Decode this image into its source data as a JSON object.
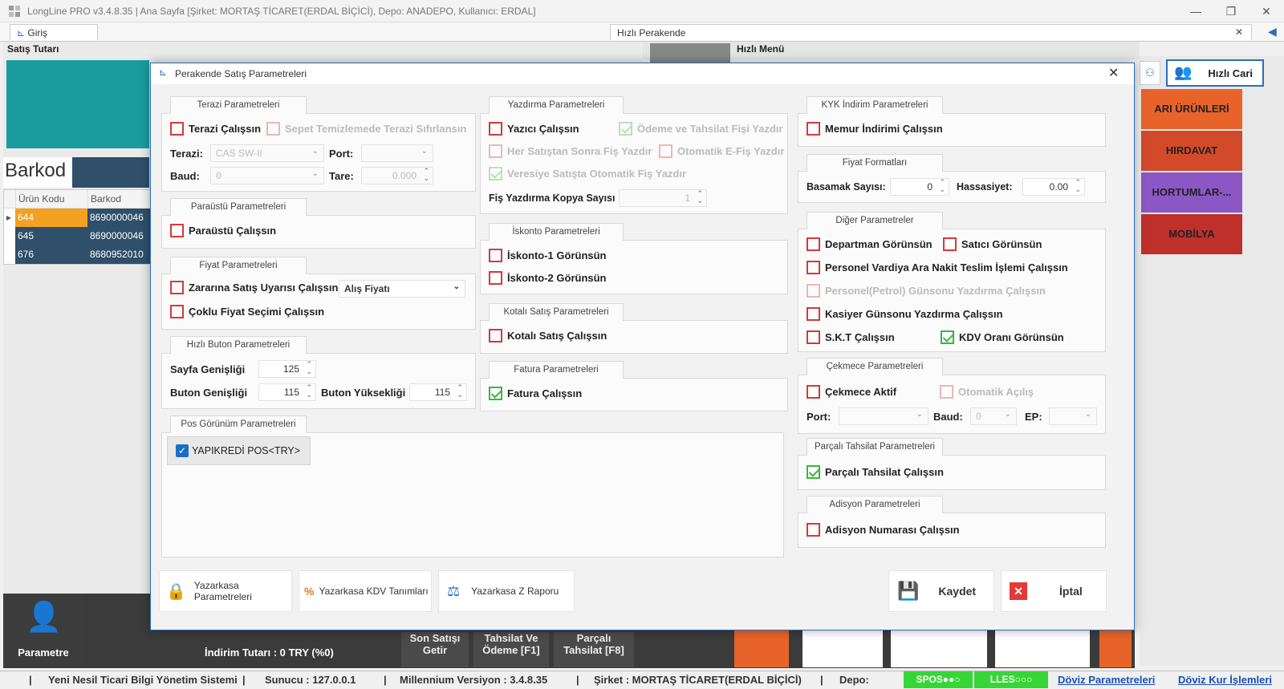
{
  "window": {
    "title": "LongLine PRO v3.4.8.35 | Ana Sayfa [Şirket: MORTAŞ TİCARET(ERDAL BİÇİCİ), Depo: ANADEPO, Kullanıcı: ERDAL]",
    "minimize": "—",
    "maximize": "❐",
    "close": "✕"
  },
  "tabs": {
    "giris": "Giriş",
    "hizli_perakende": "Hızlı Perakende",
    "close": "✕"
  },
  "background": {
    "satis_tutan": "Satış Tutarı",
    "hizli_menu": "Hızlı Menü",
    "barkod_label": "Barkod",
    "grid_headers": [
      "Ürün Kodu",
      "Barkod"
    ],
    "grid_rows": [
      {
        "kod": "644",
        "barkod": "8690000046"
      },
      {
        "kod": "645",
        "barkod": "8690000046"
      },
      {
        "kod": "676",
        "barkod": "8680952010"
      }
    ],
    "hizli_cari": "Hızlı Cari",
    "categories": [
      {
        "label": "ARI ÜRÜNLERİ",
        "color": "#e8632a"
      },
      {
        "label": "HIRDAVAT",
        "color": "#d24a2a"
      },
      {
        "label": "HORTUMLAR-...",
        "color": "#8a57c4"
      },
      {
        "label": "MOBİLYA",
        "color": "#c0302a"
      }
    ],
    "parametre": "Parametre",
    "indirim_tutari": "İndirim Tutarı : 0 TRY (%0)",
    "son_satisi_getir": [
      "Son Satışı",
      "Getir"
    ],
    "tahsilat_ve_odeme": [
      "Tahsilat Ve",
      "Ödeme [F1]"
    ],
    "parcali_tahsilat": [
      "Parçalı",
      "Tahsilat [F8]"
    ]
  },
  "status": {
    "sep": "|",
    "system": "Yeni Nesil Ticari Bilgi Yönetim Sistemi",
    "sunucu": "Sunucu :  127.0.0.1",
    "version": "Millennium Versiyon :   3.4.8.35",
    "sirket": "Şirket :   MORTAŞ TİCARET(ERDAL BİÇİCİ)",
    "depo": "Depo:",
    "spos": "SPOS●●○",
    "lles": "LLES○○○",
    "doviz_param": "Döviz Parametreleri",
    "doviz_kur": "Döviz Kur İşlemleri"
  },
  "dialog": {
    "title": "Perakende Satış Parametreleri",
    "close": "✕",
    "terazi": {
      "tab": "Terazi Parametreleri",
      "terazi_calissin": "Terazi Çalışsın",
      "sepet_temizle": "Sepet Temizlemede Terazi Sıfırlansın",
      "terazi_label": "Terazi:",
      "terazi_value": "CAS SW-II",
      "port_label": "Port:",
      "port_value": "",
      "baud_label": "Baud:",
      "baud_value": "0",
      "tare_label": "Tare:",
      "tare_value": "0.000"
    },
    "paraustu": {
      "tab": "Paraüstü Parametreleri",
      "paraustu_calissin": "Paraüstü Çalışsın"
    },
    "fiyat": {
      "tab": "Fiyat Parametreleri",
      "zarar": "Zararına Satış Uyarısı Çalışsın",
      "zarar_select": "Alış Fiyatı",
      "coklu": "Çoklu Fiyat Seçimi Çalışsın"
    },
    "hizli_buton": {
      "tab": "Hızlı Buton Parametreleri",
      "sayfa_label": "Sayfa Genişliği",
      "sayfa_value": "125",
      "buton_gen_label": "Buton Genişliği",
      "buton_gen_value": "115",
      "buton_yuk_label": "Buton Yüksekliği",
      "buton_yuk_value": "115"
    },
    "pos": {
      "tab": "Pos Görünüm Parametreleri",
      "item": "YAPIKREDİ POS<TRY>"
    },
    "yazdirma": {
      "tab": "Yazdırma Parametreleri",
      "yazici": "Yazıcı Çalışsın",
      "odeme_fisi": "Ödeme ve Tahsilat Fişi Yazdır",
      "her_satistan": "Her Satıştan Sonra Fiş Yazdır",
      "otomatik_efis": "Otomatik E-Fiş Yazdır",
      "veresiye": "Veresiye Satışta Otomatik Fiş Yazdır",
      "kopya_label": "Fiş Yazdırma Kopya Sayısı",
      "kopya_value": "1"
    },
    "iskonto": {
      "tab": "İskonto Parametreleri",
      "isk1": "İskonto-1 Görünsün",
      "isk2": "İskonto-2 Görünsün"
    },
    "kotali": {
      "tab": "Kotalı Satış Parametreleri",
      "kotali": "Kotalı Satış Çalışsın"
    },
    "fatura": {
      "tab": "Fatura Parametreleri",
      "fatura": "Fatura Çalışsın"
    },
    "kyk": {
      "tab": "KYK İndirim Parametreleri",
      "memur": "Memur İndirimi Çalışsın"
    },
    "fiyat_format": {
      "tab": "Fiyat Formatları",
      "basamak_label": "Basamak Sayısı:",
      "basamak_value": "0",
      "hassasiyet_label": "Hassasiyet:",
      "hassasiyet_value": "0.00"
    },
    "diger": {
      "tab": "Diğer Parametreler",
      "departman": "Departman Görünsün",
      "satici": "Satıcı Görünsün",
      "vardiya": "Personel Vardiya Ara Nakit Teslim İşlemi Çalışsın",
      "petrol": "Personel(Petrol) Günsonu Yazdırma Çalışsın",
      "kasiyer": "Kasiyer Günsonu Yazdırma Çalışsın",
      "skt": "S.K.T Çalışsın",
      "kdv": "KDV Oranı Görünsün"
    },
    "cekmece": {
      "tab": "Çekmece Parametreleri",
      "aktif": "Çekmece Aktif",
      "otomatik": "Otomatik Açılış",
      "port_label": "Port:",
      "port_value": "",
      "baud_label": "Baud:",
      "baud_value": "0",
      "ep_label": "EP:",
      "ep_value": ""
    },
    "parcali": {
      "tab": "Parçalı Tahsilat Parametreleri",
      "parcali": "Parçalı Tahsilat Çalışsın"
    },
    "adisyon": {
      "tab": "Adisyon Parametreleri",
      "adisyon": "Adisyon Numarası Çalışsın"
    },
    "footer": {
      "yazarkasa_param": "Yazarkasa Parametreleri",
      "yazarkasa_kdv": "Yazarkasa KDV Tanımları",
      "yazarkasa_z": "Yazarkasa Z Raporu",
      "kaydet": "Kaydet",
      "iptal": "İptal"
    }
  }
}
